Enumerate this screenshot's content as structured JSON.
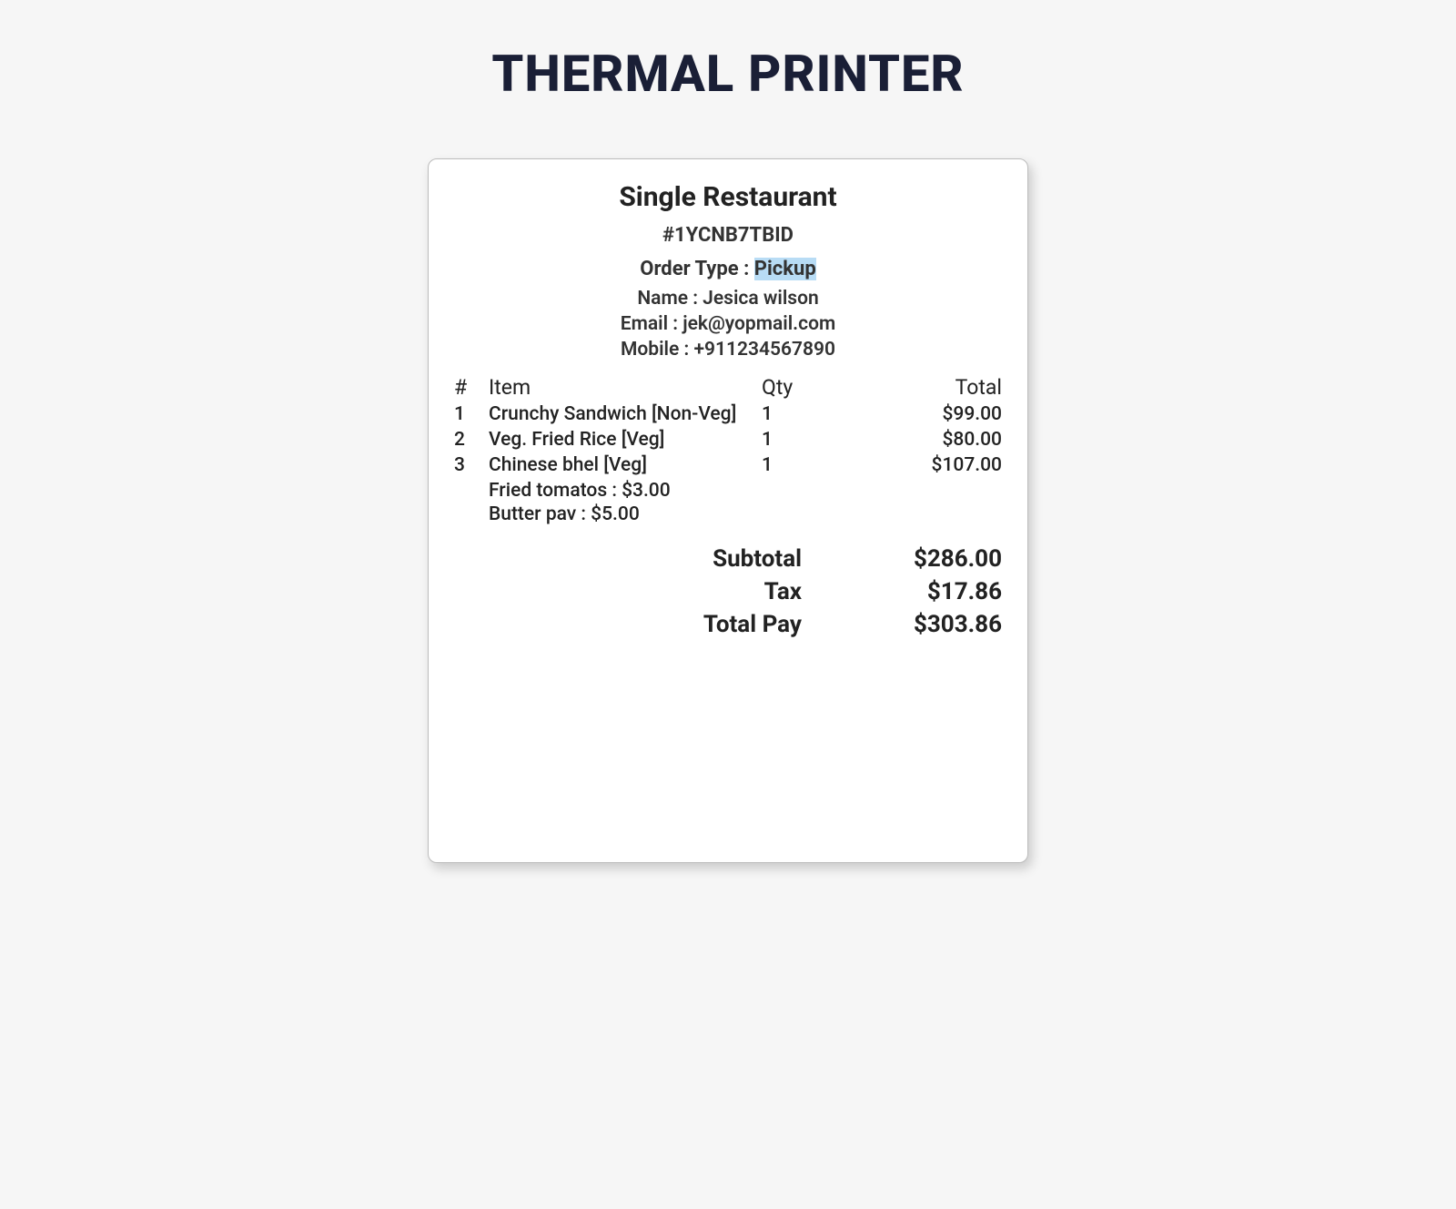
{
  "pageTitle": "THERMAL PRINTER",
  "receipt": {
    "restaurantName": "Single Restaurant",
    "orderId": "#1YCNB7TBID",
    "orderTypeLabel": "Order Type : ",
    "orderTypeValue": "Pickup",
    "customer": {
      "nameLabel": "Name : ",
      "name": "Jesica wilson",
      "emailLabel": "Email : ",
      "email": "jek@yopmail.com",
      "mobileLabel": "Mobile : ",
      "mobile": "+911234567890"
    },
    "headers": {
      "index": "#",
      "item": "Item",
      "qty": "Qty",
      "total": "Total"
    },
    "items": [
      {
        "idx": "1",
        "name": "Crunchy Sandwich [Non-Veg]",
        "qty": "1",
        "total": "$99.00"
      },
      {
        "idx": "2",
        "name": "Veg. Fried Rice [Veg]",
        "qty": "1",
        "total": "$80.00"
      },
      {
        "idx": "3",
        "name": "Chinese bhel [Veg]",
        "qty": "1",
        "total": "$107.00"
      }
    ],
    "extras": [
      "Fried tomatos : $3.00",
      "Butter pav : $5.00"
    ],
    "totals": {
      "subtotalLabel": "Subtotal",
      "subtotal": "$286.00",
      "taxLabel": "Tax",
      "tax": "$17.86",
      "totalPayLabel": "Total Pay",
      "totalPay": "$303.86"
    }
  }
}
